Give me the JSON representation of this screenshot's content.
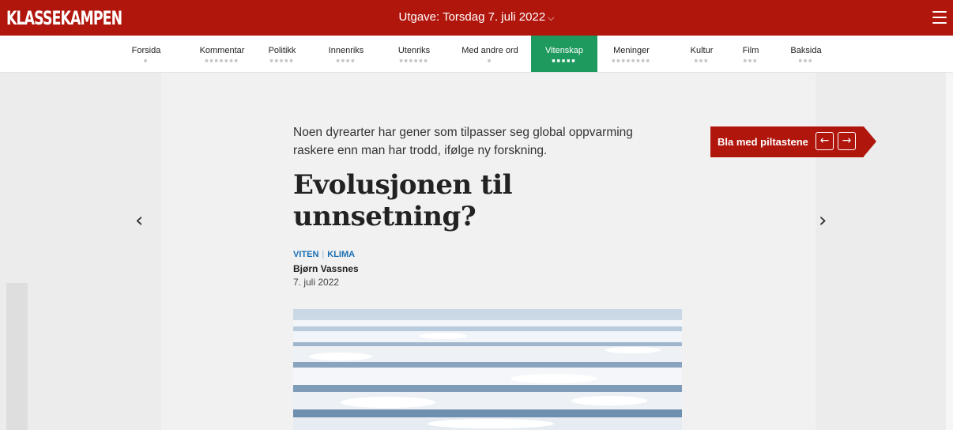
{
  "header": {
    "logo": "KLASSEKAMPEN",
    "edition_label": "Utgave: Torsdag 7. juli 2022",
    "edition_chevron": "⌵"
  },
  "nav": {
    "items": [
      {
        "label": "Forsida",
        "dots": "■"
      },
      {
        "label": "Kommentar",
        "dots": "■■■■■■■"
      },
      {
        "label": "Politikk",
        "dots": "■■■■■"
      },
      {
        "label": "Innenriks",
        "dots": "■■■■"
      },
      {
        "label": "Utenriks",
        "dots": "■■■■■■"
      },
      {
        "label": "Med andre ord",
        "dots": "■"
      },
      {
        "label": "Vitenskap",
        "dots": "■■■■■"
      },
      {
        "label": "Meninger",
        "dots": "■■■■■■■■"
      },
      {
        "label": "Kultur",
        "dots": "■■■"
      },
      {
        "label": "Film",
        "dots": "■■■"
      },
      {
        "label": "Baksida",
        "dots": "■■■"
      }
    ],
    "active": "Vitenskap"
  },
  "article": {
    "lead": "Noen dyrearter har gener som tilpasser seg global oppvarming raskere enn man har trodd, ifølge ny forskning.",
    "headline": "Evolusjonen til unnsetning?",
    "tags": [
      "VITEN",
      "KLIMA"
    ],
    "author": "Bjørn Vassnes",
    "date": "7. juli 2022"
  },
  "callout": {
    "text": "Bla med piltastene",
    "left_key": "←",
    "right_key": "→"
  },
  "pager": {
    "prev": "‹",
    "next": "›"
  },
  "colors": {
    "brand_red": "#b1160d",
    "active_tab": "#1f9a5e",
    "tag_blue": "#1a6fb3"
  },
  "icons": [
    "hamburger-menu-icon",
    "chevron-left-icon",
    "chevron-right-icon",
    "arrow-left-icon",
    "arrow-right-icon"
  ]
}
